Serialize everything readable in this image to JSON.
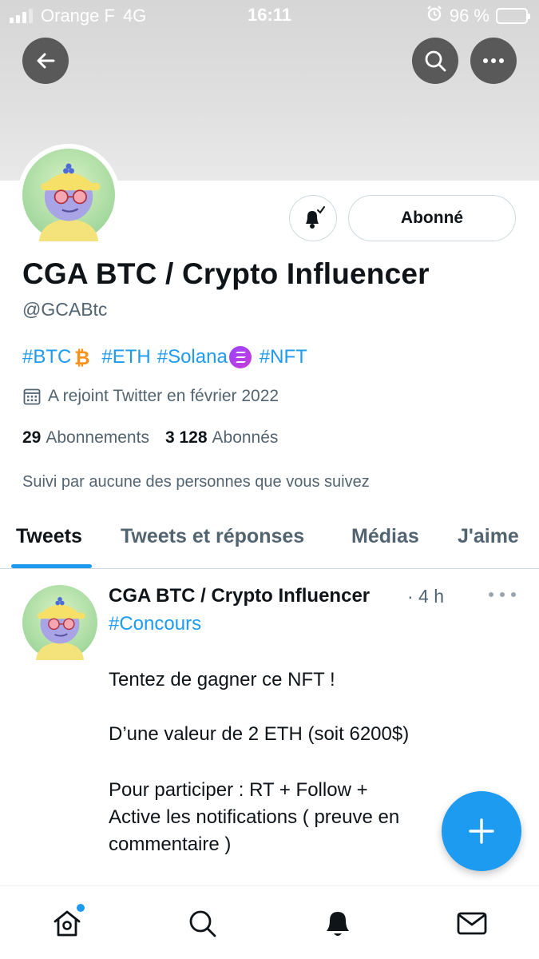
{
  "status_bar": {
    "carrier": "Orange F",
    "network": "4G",
    "time": "16:11",
    "battery": "96 %",
    "battery_level": 0.96
  },
  "profile": {
    "follow_button": "Abonné",
    "name": "CGA BTC / Crypto Influencer",
    "handle": "@GCABtc",
    "bio_tags": [
      "#BTC",
      "#ETH",
      "#Solana",
      "#NFT"
    ],
    "joined": "A rejoint Twitter en février 2022",
    "following_count": "29",
    "following_label": "Abonnements",
    "followers_count": "3 128",
    "followers_label": "Abonnés",
    "followed_by": "Suivi par aucune des personnes que vous suivez"
  },
  "tabs": [
    {
      "label": "Tweets",
      "active": true
    },
    {
      "label": "Tweets et réponses",
      "active": false
    },
    {
      "label": "Médias",
      "active": false
    },
    {
      "label": "J'aime",
      "active": false
    }
  ],
  "tweet": {
    "author": "CGA BTC / Crypto Influencer",
    "time": "· 4 h",
    "hashtag": "#Concours",
    "lines": [
      "Tentez de gagner ce NFT !",
      "D’une valeur de 2 ETH (soit 6200$)",
      "Pour participer : RT + Follow +",
      "Active les notifications ( preuve en",
      "commentaire )"
    ]
  },
  "colors": {
    "accent": "#1d9bf0",
    "text_secondary": "#536471",
    "bitcoin": "#f7931a"
  },
  "icons": [
    "back-arrow-icon",
    "search-icon",
    "more-icon",
    "bell-check-icon",
    "calendar-icon",
    "compose-plus-icon",
    "home-icon",
    "explore-search-icon",
    "notifications-bell-icon",
    "messages-envelope-icon"
  ]
}
